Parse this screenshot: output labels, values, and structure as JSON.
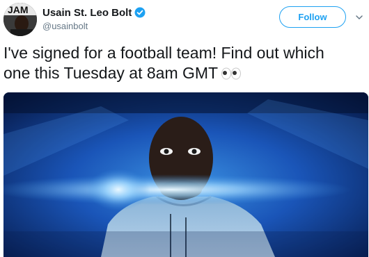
{
  "author": {
    "display_name": "Usain St. Leo Bolt",
    "handle": "@usainbolt",
    "verified": true,
    "avatar_icon": "profile-photo"
  },
  "follow_button": {
    "label": "Follow"
  },
  "menu": {
    "icon": "chevron-down-icon"
  },
  "tweet": {
    "text_line_1": "I've signed for a football team! Find out which",
    "text_line_2": "one this Tuesday at 8am GMT",
    "emoji": "eyes-emoji"
  },
  "media": {
    "type": "video-still",
    "description_icon": "video-thumbnail"
  },
  "colors": {
    "accent": "#1da1f2",
    "text": "#14171a",
    "secondary_text": "#657786",
    "media_background": "#0a2a6a"
  }
}
